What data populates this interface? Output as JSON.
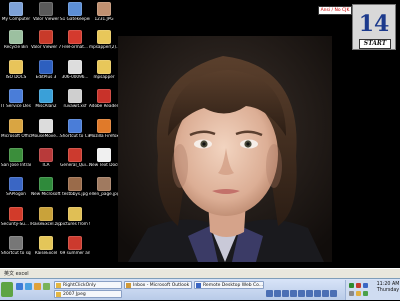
{
  "desktop_icons": [
    {
      "label": "My Computer",
      "color": "#7da1d6",
      "icon": "computer-icon"
    },
    {
      "label": "Recycle Bin",
      "color": "#9cc0a0",
      "icon": "recycle-bin-icon"
    },
    {
      "label": "ISO DOCS",
      "color": "#e8c45a",
      "icon": "folder-icon"
    },
    {
      "label": "IT Service Desk",
      "color": "#4a7dd8",
      "icon": "shortcut-icon"
    },
    {
      "label": "Microsoft Office Out...",
      "color": "#d9a542",
      "icon": "outlook-icon"
    },
    {
      "label": "San Jose Intranet",
      "color": "#3b8e3b",
      "icon": "web-icon"
    },
    {
      "label": "SAPlogon",
      "color": "#3a66c4",
      "icon": "sap-icon"
    },
    {
      "label": "Security-Su... Reporting.la...",
      "color": "#d23b2a",
      "icon": "security-icon"
    },
    {
      "label": "Shortcut to sqlM",
      "color": "#777777",
      "icon": "sql-icon"
    },
    {
      "label": "Valor Viewer",
      "color": "#5a5a5a",
      "icon": "viewer-icon"
    },
    {
      "label": "Valor Viewer 7.0",
      "color": "#c83a2a",
      "icon": "viewer-icon"
    },
    {
      "label": "EditPlus 3",
      "color": "#2d5fbf",
      "icon": "editor-icon"
    },
    {
      "label": "MiscAlan2",
      "color": "#3aa0d8",
      "icon": "folder-icon"
    },
    {
      "label": "MouseMove... Dist",
      "color": "#dcdcdc",
      "icon": "app-icon"
    },
    {
      "label": "ICA",
      "color": "#b83a3a",
      "icon": "ica-icon"
    },
    {
      "label": "New Microsoft Excel Work...",
      "color": "#2f8a3b",
      "icon": "excel-icon"
    },
    {
      "label": "RaiseExcel.zip",
      "color": "#c9a23a",
      "icon": "zip-icon"
    },
    {
      "label": "RaiseExcel",
      "color": "#e4c659",
      "icon": "folder-icon"
    },
    {
      "label": "S1 Gatekeeper ...",
      "color": "#5c8fd6",
      "icon": "app-icon"
    },
    {
      "label": "FileFormat...",
      "color": "#d43a2e",
      "icon": "file-icon"
    },
    {
      "label": "306-00096...",
      "color": "#dddddd",
      "icon": "document-icon"
    },
    {
      "label": "ruvawit.xsf",
      "color": "#cfcfcf",
      "icon": "document-icon"
    },
    {
      "label": "Shortcut to CiscoVn-Wirel...",
      "color": "#4a7dd8",
      "icon": "shortcut-icon"
    },
    {
      "label": "General_Qui...",
      "color": "#cc3a2e",
      "icon": "pdf-icon"
    },
    {
      "label": "testbbys.jpg",
      "color": "#9a6b4a",
      "icon": "image-icon"
    },
    {
      "label": "pictures from timothy",
      "color": "#e0bf55",
      "icon": "folder-icon"
    },
    {
      "label": "69 summer and Fall.pdf",
      "color": "#cc3a2e",
      "icon": "pdf-icon"
    },
    {
      "label": "1231.JPG",
      "color": "#c09070",
      "icon": "image-icon"
    },
    {
      "label": "mpsapper(2)...",
      "color": "#e8c75a",
      "icon": "folder-icon"
    },
    {
      "label": "mpsapper",
      "color": "#e8c75a",
      "icon": "folder-icon"
    },
    {
      "label": "Adobe Reader 7.0",
      "color": "#c8322a",
      "icon": "adobe-icon"
    },
    {
      "label": "Mozilla Firefox",
      "color": "#e07a2a",
      "icon": "firefox-icon"
    },
    {
      "label": "New Text Document.txt",
      "color": "#f0f0f0",
      "icon": "text-file-icon"
    },
    {
      "label": "ellen_page.jpg",
      "color": "#a07a60",
      "icon": "image-icon"
    }
  ],
  "date_widget": {
    "day": "14",
    "button": "START"
  },
  "ime_bar": {
    "text": "Ansi / No CJK"
  },
  "language_bar": {
    "text": "英文 excel"
  },
  "taskbar": {
    "tasks": [
      {
        "label": "RightClickOnly",
        "color": "#e3b744",
        "icon": "folder-icon"
      },
      {
        "label": "2007 Jpeg",
        "color": "#e3b744",
        "icon": "folder-icon"
      },
      {
        "label": "Inbox - Microsoft Outlook",
        "color": "#d09a3a",
        "icon": "outlook-icon"
      },
      {
        "label": "Remote Desktop Web Co...",
        "color": "#3a66c4",
        "icon": "remote-desktop-icon"
      }
    ],
    "clock_time": "11:20 AM",
    "clock_day": "Thursday"
  }
}
